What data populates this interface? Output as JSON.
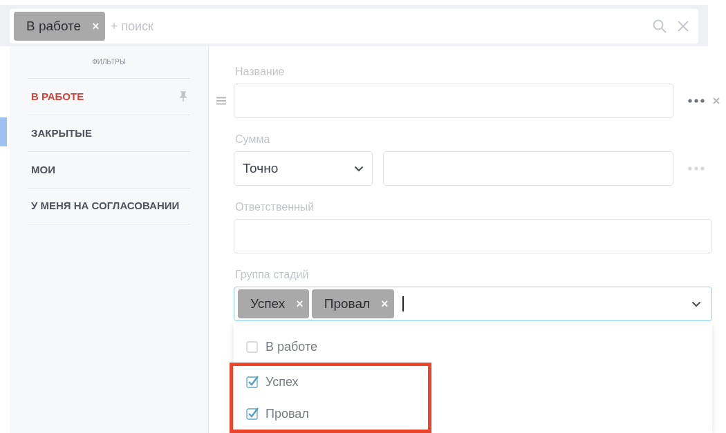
{
  "search": {
    "chips": [
      {
        "label": "В работе",
        "remove": "×"
      }
    ],
    "placeholder": "+ поиск"
  },
  "sidebar": {
    "title": "ФИЛЬТРЫ",
    "items": [
      {
        "label": "В РАБОТЕ",
        "selected": true,
        "pinned": true
      },
      {
        "label": "ЗАКРЫТЫЕ",
        "selected": false,
        "pinned": false
      },
      {
        "label": "МОИ",
        "selected": false,
        "pinned": false
      },
      {
        "label": "У МЕНЯ НА СОГЛАСОВАНИИ",
        "selected": false,
        "pinned": false
      }
    ]
  },
  "fields": [
    {
      "kind": "text",
      "label": "Название",
      "menu_disabled": false,
      "removable": true
    },
    {
      "kind": "range",
      "label": "Сумма",
      "select_value": "Точно",
      "menu_disabled": true
    },
    {
      "kind": "wide",
      "label": "Ответственный"
    },
    {
      "kind": "multi",
      "label": "Группа стадий",
      "focused": true,
      "chips": [
        {
          "label": "Успех",
          "remove": "×"
        },
        {
          "label": "Провал",
          "remove": "×"
        }
      ]
    }
  ],
  "dropdown": {
    "options": [
      {
        "label": "В работе",
        "checked": false
      },
      {
        "label": "Успех",
        "checked": true,
        "highlighted": true
      },
      {
        "label": "Провал",
        "checked": true,
        "highlighted": true
      }
    ]
  }
}
